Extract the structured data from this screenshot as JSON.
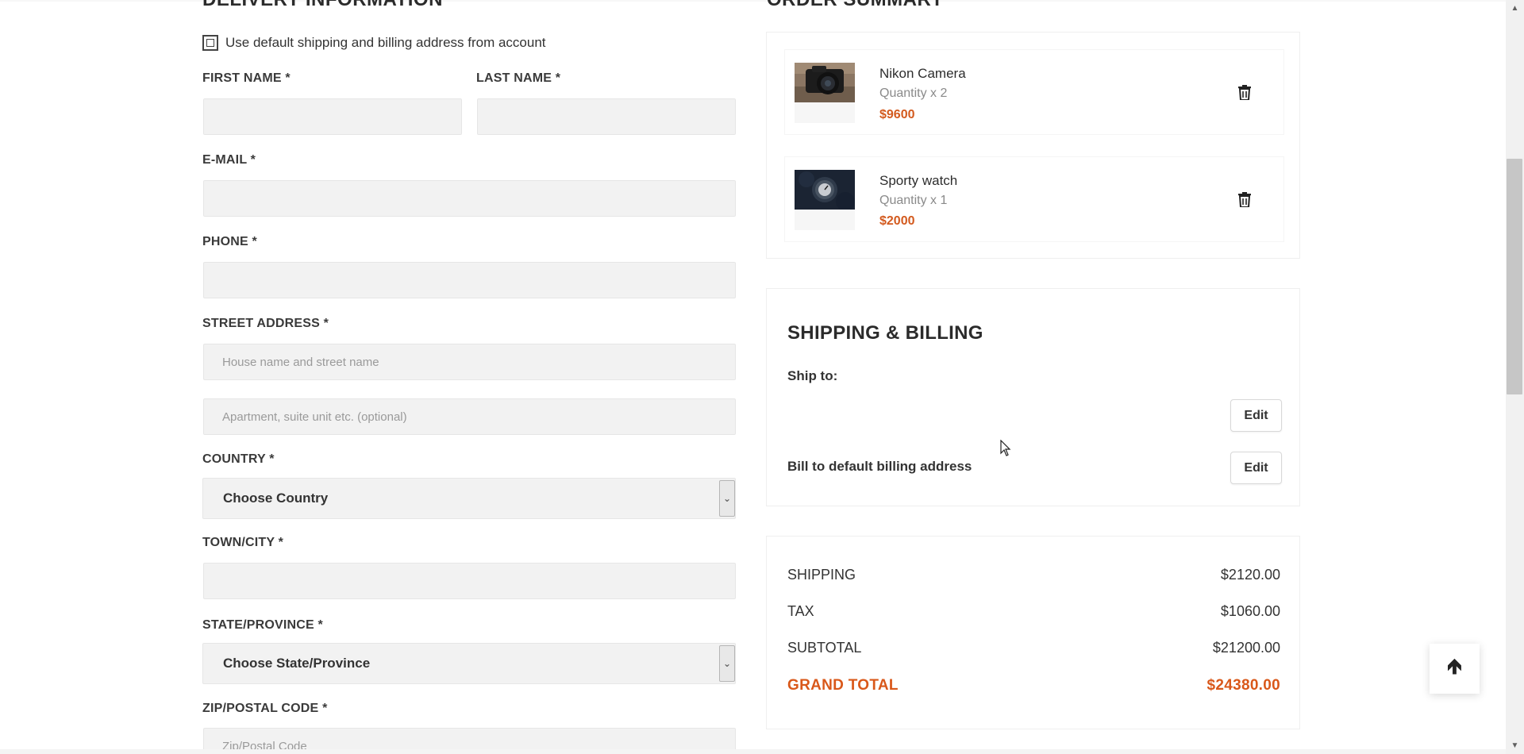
{
  "delivery": {
    "title": "DELIVERY INFORMATION",
    "default_address_label": "Use default shipping and billing address from account",
    "first_name_label": "FIRST NAME *",
    "last_name_label": "LAST NAME *",
    "email_label": "E-MAIL *",
    "phone_label": "PHONE *",
    "street_label": "STREET ADDRESS *",
    "street_placeholder": "House name and street name",
    "apartment_placeholder": "Apartment, suite unit etc. (optional)",
    "country_label": "COUNTRY *",
    "country_value": "Choose Country",
    "town_label": "TOWN/CITY *",
    "state_label": "STATE/PROVINCE *",
    "state_value": "Choose State/Province",
    "zip_label": "ZIP/POSTAL CODE *",
    "zip_placeholder": "Zip/Postal Code"
  },
  "order_summary": {
    "title": "ORDER SUMMARY",
    "items": [
      {
        "name": "Nikon Camera",
        "quantity": "Quantity x 2",
        "price": "$9600",
        "image": "camera"
      },
      {
        "name": "Sporty watch",
        "quantity": "Quantity x 1",
        "price": "$2000",
        "image": "watch"
      }
    ]
  },
  "shipping_billing": {
    "title": "SHIPPING & BILLING",
    "ship_to_label": "Ship to:",
    "edit_label": "Edit",
    "bill_to_label": "Bill to default billing address"
  },
  "totals": {
    "shipping_label": "SHIPPING",
    "shipping_value": "$2120.00",
    "tax_label": "TAX",
    "tax_value": "$1060.00",
    "subtotal_label": "SUBTOTAL",
    "subtotal_value": "$21200.00",
    "grand_total_label": "GRAND TOTAL",
    "grand_total_value": "$24380.00"
  },
  "colors": {
    "accent": "#d9581a",
    "field_bg": "#f2f2f2"
  },
  "icons": {
    "trash": "trash-icon",
    "scroll_top": "arrow-up-icon",
    "select": "chevron-down-icon"
  }
}
